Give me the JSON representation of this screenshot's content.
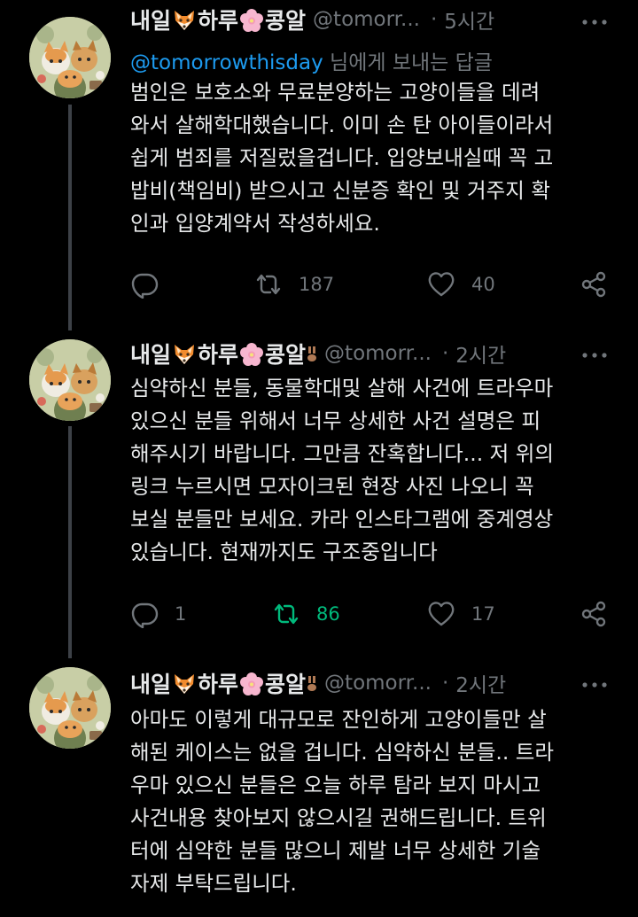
{
  "tweets": [
    {
      "name_parts": [
        "내일",
        "하루",
        "콩알"
      ],
      "handle": "@tomorr...",
      "dot": "·",
      "time": "5시간",
      "reply_prefix": "@tomorrowthisday",
      "reply_suffix": " 님에게 보내는 답글",
      "lines": [
        "범인은 보호소와 무료분양하는 고양이들을 데려",
        "와서 살해학대했습니다. 이미 손 탄 아이들이라서",
        "쉽게 범죄를 저질렀을겁니다. 입양보내실때 꼭 고",
        "밥비(책임비) 받으시고 신분증 확인 및 거주지 확",
        "인과 입양계약서 작성하세요."
      ],
      "reply_count": "",
      "retweet_count": "187",
      "like_count": "40",
      "retweeted": false
    },
    {
      "name_parts": [
        "내일",
        "하루",
        "콩알"
      ],
      "handle": "@tomorr...",
      "dot": "·",
      "time": "2시간",
      "lines": [
        "심약하신 분들, 동물학대및 살해 사건에 트라우마",
        "있으신 분들 위해서 너무 상세한 사건 설명은 피",
        "해주시기 바랍니다. 그만큼 잔혹합니다... 저 위의",
        "링크 누르시면 모자이크된 현장 사진 나오니 꼭",
        "보실 분들만 보세요. 카라 인스타그램에 중계영상",
        "있습니다. 현재까지도 구조중입니다"
      ],
      "reply_count": "1",
      "retweet_count": "86",
      "like_count": "17",
      "retweeted": true
    },
    {
      "name_parts": [
        "내일",
        "하루",
        "콩알"
      ],
      "handle": "@tomorr...",
      "dot": "·",
      "time": "2시간",
      "lines": [
        "아마도 이렇게 대규모로 잔인하게 고양이들만 살",
        "해된 케이스는 없을 겁니다. 심약하신 분들.. 트라",
        "우마 있으신 분들은 오늘 하루 탐라 보지 마시고",
        "사건내용 찾아보지 않으시길 권해드립니다. 트위",
        "터에 심약한 분들 많으니 제발 너무 상세한 기술",
        "자제 부탁드립니다."
      ]
    }
  ],
  "icons": {
    "name_emoji_1": "fox-face-icon",
    "name_emoji_2": "cherry-blossom-icon",
    "name_trailing": "paw-icon",
    "more": "more-dots-icon",
    "reply": "reply-icon",
    "retweet": "retweet-icon",
    "like": "heart-icon",
    "share": "share-icon"
  },
  "colors": {
    "background": "#000000",
    "text": "#e7e9ea",
    "secondary": "#71767b",
    "link": "#1d9bf0",
    "retweet_active": "#00ba7c",
    "thread_line": "#3d4147"
  }
}
